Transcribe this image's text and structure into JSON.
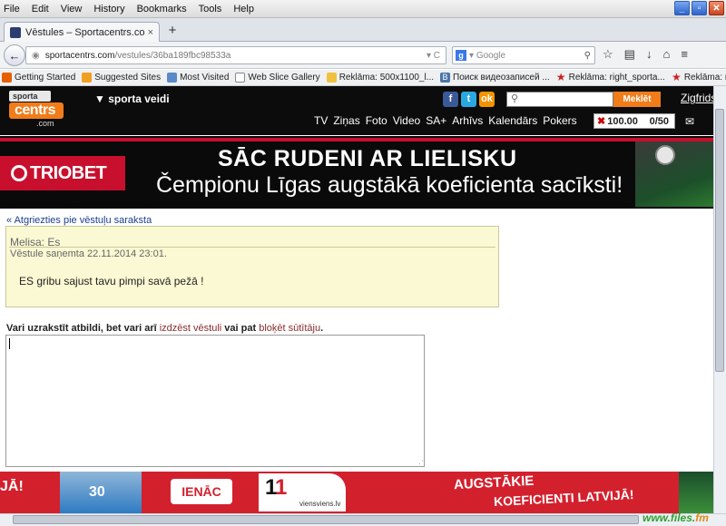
{
  "menu": [
    "File",
    "Edit",
    "View",
    "History",
    "Bookmarks",
    "Tools",
    "Help"
  ],
  "tab": {
    "title": "Vēstules – Sportacentrs.com",
    "close": "×",
    "new": "+"
  },
  "nav": {
    "back": "←",
    "url_host": "sportacentrs.com",
    "url_path": "/vestules/36ba189fbc98533a",
    "reload": "▾ C",
    "search_placeholder": "Google",
    "icons": [
      "☆",
      "▤",
      "↓",
      "⌂",
      "≡"
    ]
  },
  "bookmarks": [
    {
      "label": "Getting Started",
      "color": "#e66000"
    },
    {
      "label": "Suggested Sites",
      "color": "#f0a020"
    },
    {
      "label": "Most Visited",
      "color": "#5a8ac8"
    },
    {
      "label": "Web Slice Gallery",
      "color": "#888888"
    },
    {
      "label": "Reklāma: 500x1100_l...",
      "color": "#f0c040"
    },
    {
      "label": "Поиск видеозаписей ...",
      "color": "#4a76a8"
    },
    {
      "label": "Reklāma: right_sporta...",
      "color": "#d02020"
    },
    {
      "label": "Reklāma: right_sporta...",
      "color": "#d02020"
    }
  ],
  "site": {
    "logo_top": "sporta",
    "logo_mid": "centrs",
    "logo_bot": ".com",
    "sporta_veidi": "▼ sporta veidi",
    "social": [
      {
        "t": "f",
        "c": "#3b5998"
      },
      {
        "t": "t",
        "c": "#2aa9e0"
      },
      {
        "t": "ok",
        "c": "#f29400"
      }
    ],
    "search_button": "Meklēt",
    "user": "Zigfrids",
    "nav": [
      "TV",
      "Ziņas",
      "Foto",
      "Video",
      "SA+",
      "Arhīvs",
      "Kalendārs",
      "Pokers"
    ],
    "balance_icon": "✖",
    "balance": "100.00",
    "count": "0/50",
    "mail_icon": "✉"
  },
  "banner": {
    "brand": "TRIOBET",
    "headline": "SĀC RUDENI AR LIELISKU",
    "sub": "Čempionu Līgas augstākā koeficienta sacīksti!"
  },
  "message": {
    "back_link": "« Atgriezties pie vēstuļu saraksta",
    "from": "Melisa: Es",
    "date": "Vēstule saņemta 22.11.2014 23:01.",
    "body": "ES gribu sajust tavu pimpi savā pežā !",
    "reply_prefix": "Vari uzrakstīt atbildi, bet vari arī",
    "reply_delete": "izdzēst vēstuli",
    "reply_middle": "vai pat",
    "reply_block": "bloķēt sūtītāju",
    "reply_suffix": "."
  },
  "bottom_ad": {
    "left": "JĀ!",
    "player_num": "30",
    "cta": "IENĀC",
    "logo_a": "1",
    "logo_b": "1",
    "site": "viensviens.lv",
    "line1": "AUGSTĀKIE",
    "line2": "KOEFICIENTI LATVIJĀ!"
  },
  "watermark": {
    "a": "www.files.",
    "b": "fm"
  }
}
